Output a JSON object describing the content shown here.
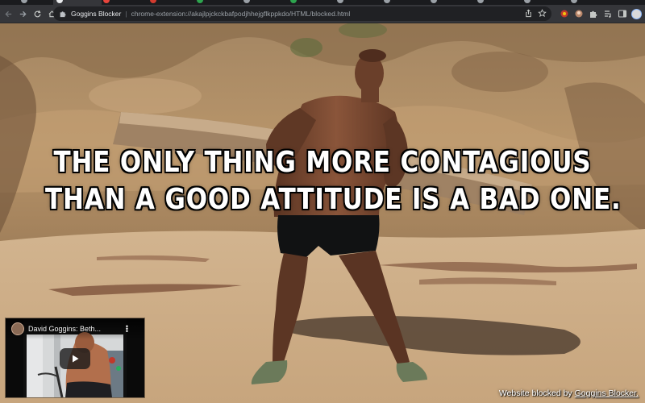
{
  "browser": {
    "site_name": "Goggins Blocker",
    "url": "chrome-extension://akajlpjckckbafpodjhhejgflkppkdo/HTML/blocked.html",
    "tabs_colors": [
      "#4c4f55",
      "#e8453c",
      "#4c4f55",
      "#d33b2f",
      "#2da44e",
      "#4c4f55",
      "#2da44e",
      "#4c4f55",
      "#4c4f55",
      "#4c4f55",
      "#4c4f55",
      "#4c4f55",
      "#4c4f55"
    ],
    "icons": {
      "back": "back-arrow-icon",
      "forward": "forward-arrow-icon",
      "reload": "reload-icon",
      "home": "home-icon",
      "extension_favicon": "puzzle-icon",
      "share": "share-icon",
      "bookmark": "star-icon",
      "profile": "profile-avatar"
    }
  },
  "page": {
    "quote_line_1": "THE ONLY THING MORE CONTAGIOUS",
    "quote_line_2": "THAN A GOOD ATTITUDE IS A BAD ONE.",
    "video": {
      "title": "David Goggins: Beth...",
      "play_icon": "play-icon",
      "menu_icon": "more-vert-icon"
    },
    "footer_prefix": "Website blocked by",
    "footer_link": "Goggins Blocker."
  }
}
